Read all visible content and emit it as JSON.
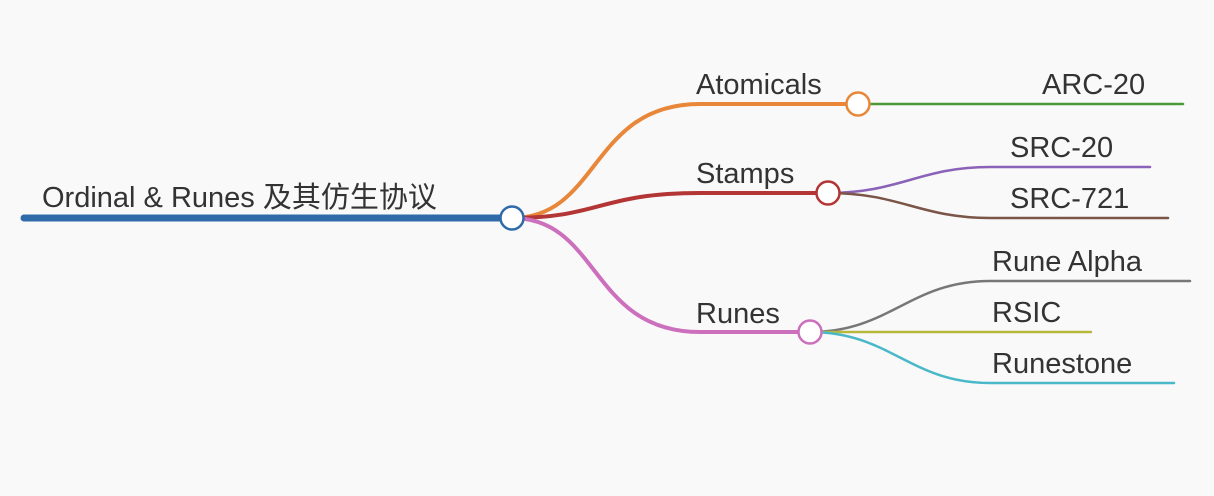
{
  "mindmap": {
    "root": {
      "label": "Ordinal & Runes 及其仿生协议",
      "color": "#2f6aa9"
    },
    "branches": [
      {
        "label": "Atomicals",
        "color": "#e8873a",
        "children": [
          {
            "label": "ARC-20",
            "color": "#4a9a3a"
          }
        ]
      },
      {
        "label": "Stamps",
        "color": "#b33535",
        "children": [
          {
            "label": "SRC-20",
            "color": "#8a62b8"
          },
          {
            "label": "SRC-721",
            "color": "#7a5548"
          }
        ]
      },
      {
        "label": "Runes",
        "color": "#cc6fbd",
        "children": [
          {
            "label": "Rune Alpha",
            "color": "#777777"
          },
          {
            "label": "RSIC",
            "color": "#b7b83c"
          },
          {
            "label": "Runestone",
            "color": "#49b8c9"
          }
        ]
      }
    ]
  }
}
